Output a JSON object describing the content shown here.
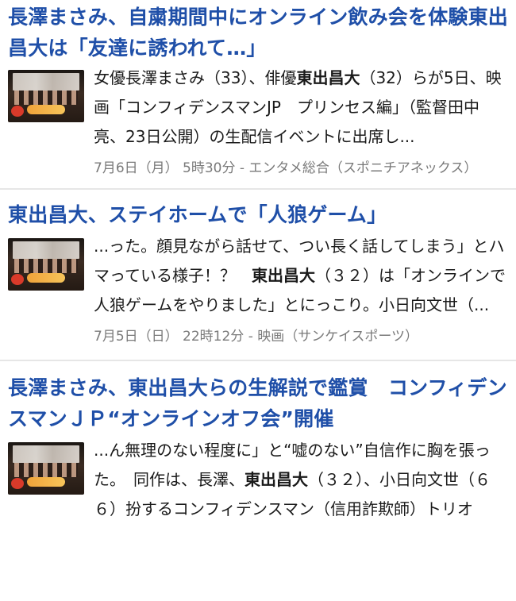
{
  "articles": [
    {
      "title_pre": "長澤まさみ、自粛期間中にオンライン飲み会を体験",
      "title_bold": "東出昌大",
      "title_post": "は「友達に誘われて…」",
      "thumb_icon": "event-photo-thumbnail",
      "snippet_pre": "女優長澤まさみ（33）、俳優",
      "snippet_bold": "東出昌大",
      "snippet_post": "（32）らが5日、映画「コンフィデンスマンJP　プリンセス編」（監督田中亮、23日公開）の生配信イベントに出席し...",
      "meta": "7月6日（月） 5時30分 - エンタメ総合（スポニチアネックス）"
    },
    {
      "title_pre": "",
      "title_bold": "東出昌大",
      "title_post": "、ステイホームで「人狼ゲーム」",
      "thumb_icon": "event-photo-thumbnail",
      "snippet_pre": "...った。顔見ながら話せて、つい長く話してしまう」とハマっている様子！？　",
      "snippet_bold": "東出昌大",
      "snippet_post": "（３２）は「オンラインで人狼ゲームをやりました」とにっこり。小日向文世（...",
      "meta": "7月5日（日） 22時12分 - 映画（サンケイスポーツ）"
    },
    {
      "title_pre": "長澤まさみ、",
      "title_bold": "東出昌大",
      "title_post": "らの生解説で鑑賞　コンフィデンスマンＪＰ“オンラインオフ会”開催",
      "thumb_icon": "event-photo-thumbnail",
      "snippet_pre": "...ん無理のない程度に」と“嘘のない”自信作に胸を張った。　同作は、長澤、",
      "snippet_bold": "東出昌大",
      "snippet_post": "（３２）、小日向文世（６６）扮するコンフィデンスマン（信用詐欺師）トリオ",
      "meta": ""
    }
  ],
  "colors": {
    "title": "#1f4fa8",
    "meta": "#7a7a7a",
    "separator": "#e6e6e6"
  }
}
